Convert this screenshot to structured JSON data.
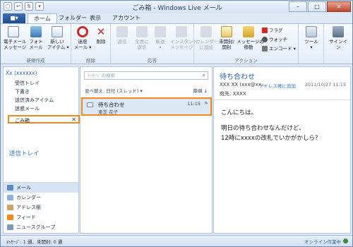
{
  "window": {
    "title": "ごみ箱 - Windows Live メール",
    "minimize": "–",
    "maximize": "□",
    "close": "✕"
  },
  "tabs": {
    "app_menu": "■▾",
    "items": [
      "ホーム",
      "フォルダー",
      "表示",
      "アカウント"
    ]
  },
  "ribbon": {
    "new_group": {
      "label": "新規作成",
      "email": "電子メール\nメッセージ",
      "photo": "フォト\nメール",
      "new_item": "新しい\nアイテム ▾"
    },
    "delete_group": {
      "label": "削除",
      "junk": "迷惑\nメール ▾",
      "delete": "削除"
    },
    "respond_group": {
      "label": "応答",
      "reply": "返信",
      "reply_all": "全員に\n返信",
      "forward": "転送\n▾",
      "im": "インスタント\nメッセージ"
    },
    "actions_group": {
      "label": "アクション",
      "calendar": "カレンダー\nに追加",
      "unread": "未開封/\n開封",
      "move": "メッセージの\n移動",
      "flag": "フラグ",
      "watch": "ウォッチ",
      "encode": "エンコード ▾"
    },
    "tools_label": "ツール\n▾",
    "signin_label": "サインイン"
  },
  "folders": {
    "account": "Xx (xxxxxx)",
    "items": [
      "受信トレイ",
      "下書き",
      "送信済みアイテム",
      "迷惑メール"
    ],
    "selected": "ごみ箱",
    "selected_close": "✕",
    "outbox": "送信トレイ"
  },
  "nav": {
    "items": [
      "メール",
      "カレンダー",
      "アドレス帳",
      "フィード",
      "ニュースグループ"
    ]
  },
  "message_list": {
    "search_placeholder": "ﾒｯｾｰｼﾞの検索",
    "sort_label": "並べ替え: 日付 (スレッド) ▾",
    "sort_order": "降順 ↓",
    "messages": [
      {
        "subject": "待ち合わせ",
        "from": "東芝 花子",
        "time": "11:15"
      }
    ]
  },
  "reading": {
    "subject": "待ち合わせ",
    "from": "XXX XX (xxx@xx...",
    "add_contact": "アドレス帳に追加",
    "date": "2011/10/27 11:15",
    "to": "宛先: XXXX",
    "body": [
      "こんにちは。",
      "明日の待ち合わせなんだけど、",
      "12時にxxxxの改札でいかがかしら？"
    ]
  },
  "status": {
    "left": "ﾒｯｾｰｼﾞ: 1 通、未開封: 0 通",
    "right": "オンライン作業中"
  }
}
